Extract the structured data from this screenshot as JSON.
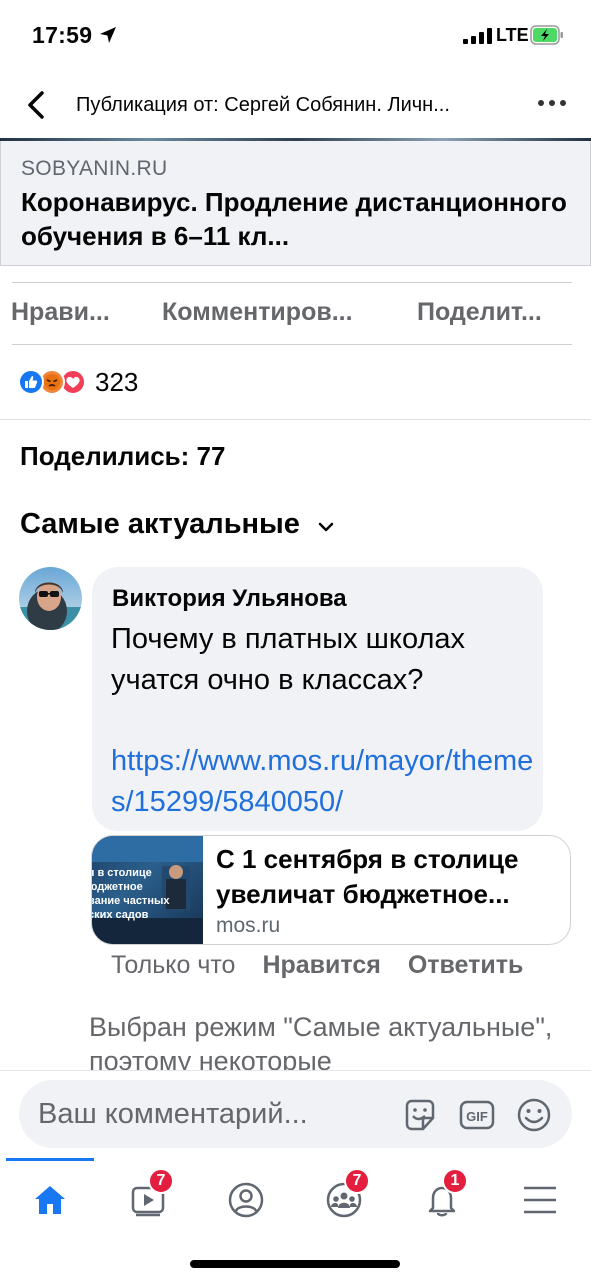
{
  "status": {
    "time": "17:59",
    "network": "LTE"
  },
  "header": {
    "title": "Публикация от: Сергей Собянин. Личн..."
  },
  "link_preview": {
    "domain": "SOBYANIN.RU",
    "title": "Коронавирус. Продление дистанционного обучения в 6–11 кл..."
  },
  "actions": {
    "like": "Нрави...",
    "comment": "Комментиров...",
    "share": "Поделит..."
  },
  "reactions": {
    "icons": [
      "like-reaction-icon",
      "angry-reaction-icon",
      "love-reaction-icon"
    ],
    "count": "323"
  },
  "shares": "Поделились: 77",
  "sort": {
    "label": "Самые актуальные"
  },
  "comment": {
    "author": "Виктория Ульянова",
    "text": "Почему в платных школах учатся очно в классах?",
    "link": "https://www.mos.ru/mayor/themes/15299/5840050/",
    "attachment": {
      "thumb_text": "я в столице\nюджетное\nвание частных\nских садов",
      "title": "С 1 сентября в столице увеличат бюджетное...",
      "domain": "mos.ru"
    },
    "time": "Только что",
    "like": "Нравится",
    "reply": "Ответить"
  },
  "notice": "Выбран режим \"Самые актуальные\", поэтому некоторые",
  "composer": {
    "placeholder": "Ваш комментарий..."
  },
  "tabbar": {
    "items": [
      {
        "icon": "home-icon",
        "badge": ""
      },
      {
        "icon": "video-icon",
        "badge": "7"
      },
      {
        "icon": "profile-icon",
        "badge": ""
      },
      {
        "icon": "groups-icon",
        "badge": "7"
      },
      {
        "icon": "bell-icon",
        "badge": "1"
      },
      {
        "icon": "menu-icon",
        "badge": ""
      }
    ]
  },
  "colors": {
    "accent": "#1877f2",
    "link": "#216fdb",
    "badge": "#e41e3f",
    "bubble": "#f0f2f5"
  }
}
